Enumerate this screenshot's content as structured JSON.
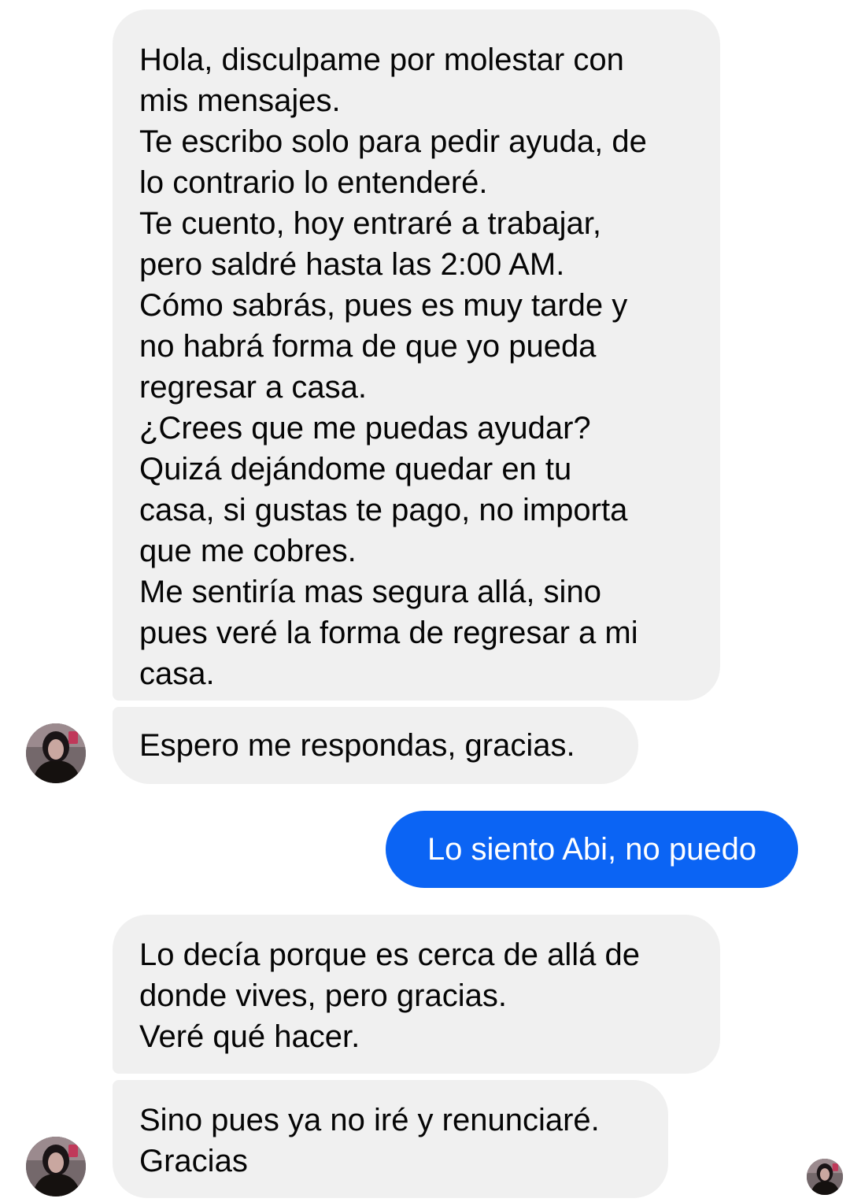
{
  "conversation": {
    "messages": [
      {
        "sender": "contact",
        "text": "Hola, disculpame por molestar con\nmis mensajes.\nTe escribo solo para pedir ayuda, de\nlo contrario lo entenderé.\nTe cuento, hoy entraré a trabajar,\npero saldré hasta las 2:00 AM.\nCómo sabrás, pues es muy tarde y\nno habrá forma de que yo pueda\nregresar a casa.\n¿Crees que me puedas ayudar?\nQuizá dejándome quedar en tu\ncasa, si gustas te pago, no importa\nque me cobres.\nMe sentiría mas segura allá, sino\npues veré la forma de regresar a mi\ncasa."
      },
      {
        "sender": "contact",
        "text": "Espero me respondas, gracias."
      },
      {
        "sender": "me",
        "text": "Lo siento Abi, no puedo"
      },
      {
        "sender": "contact",
        "text": "Lo decía porque es cerca de allá de\ndonde vives, pero gracias.\nVeré qué hacer."
      },
      {
        "sender": "contact",
        "text": "Sino pues ya no iré y renunciaré.\nGracias"
      }
    ],
    "avatar_icon": "contact-avatar-icon",
    "read_receipt_icon": "seen-avatar-icon"
  },
  "colors": {
    "incoming_bubble": "#f0f0f0",
    "outgoing_bubble": "#0b64f4",
    "incoming_text": "#050505",
    "outgoing_text": "#ffffff"
  }
}
